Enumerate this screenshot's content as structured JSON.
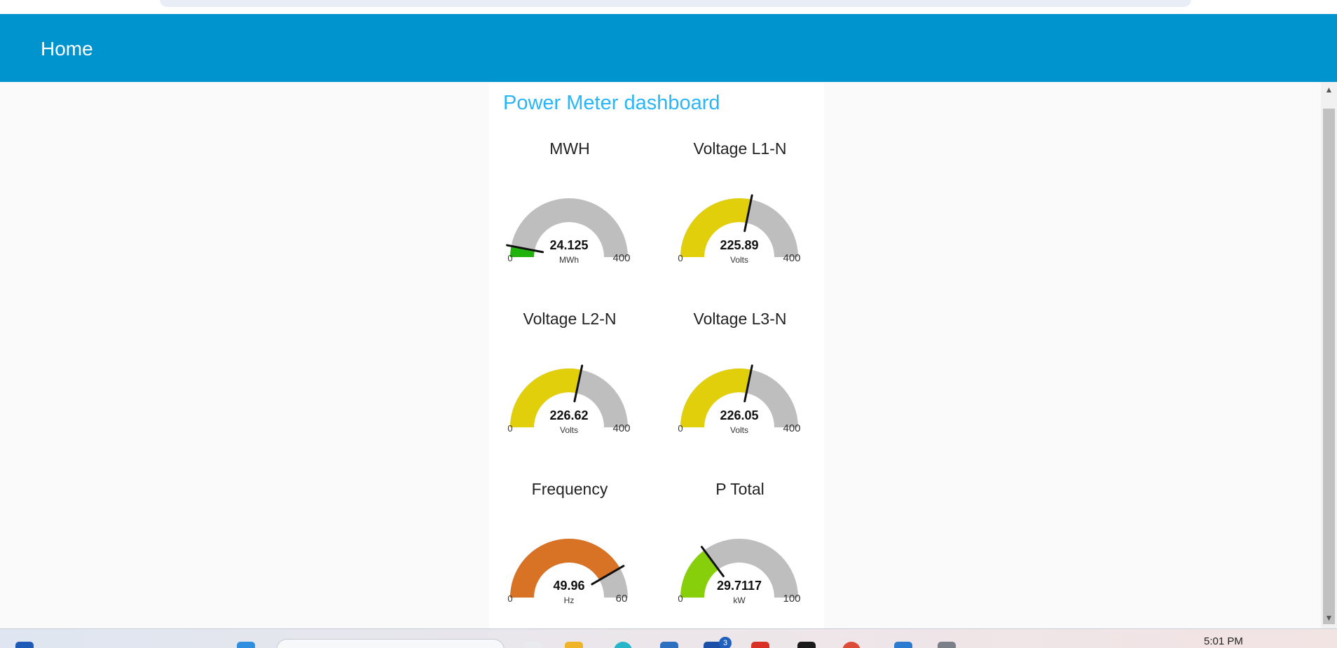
{
  "header": {
    "title": "Home"
  },
  "dashboard": {
    "group_title": "Power Meter dashboard",
    "gauges": [
      {
        "title": "MWH",
        "value": "24.125",
        "units": "MWh",
        "min": "0",
        "max": "400",
        "fraction": 0.0603,
        "color": "#22b20d"
      },
      {
        "title": "Voltage L1-N",
        "value": "225.89",
        "units": "Volts",
        "min": "0",
        "max": "400",
        "fraction": 0.5647,
        "color": "#e0cf0a"
      },
      {
        "title": "Voltage L2-N",
        "value": "226.62",
        "units": "Volts",
        "min": "0",
        "max": "400",
        "fraction": 0.5666,
        "color": "#e0cf0a"
      },
      {
        "title": "Voltage L3-N",
        "value": "226.05",
        "units": "Volts",
        "min": "0",
        "max": "400",
        "fraction": 0.5651,
        "color": "#e0cf0a"
      },
      {
        "title": "Frequency",
        "value": "49.96",
        "units": "Hz",
        "min": "0",
        "max": "60",
        "fraction": 0.8327,
        "color": "#d87225"
      },
      {
        "title": "P Total",
        "value": "29.7117",
        "units": "kW",
        "min": "0",
        "max": "100",
        "fraction": 0.2971,
        "color": "#86cf0a"
      }
    ]
  },
  "taskbar": {
    "clock": "5:01 PM",
    "badge_count": "3"
  },
  "colors": {
    "header": "#0094ce",
    "group_title": "#29b6f6",
    "gauge_track": "#bebebe",
    "needle": "#111111"
  }
}
